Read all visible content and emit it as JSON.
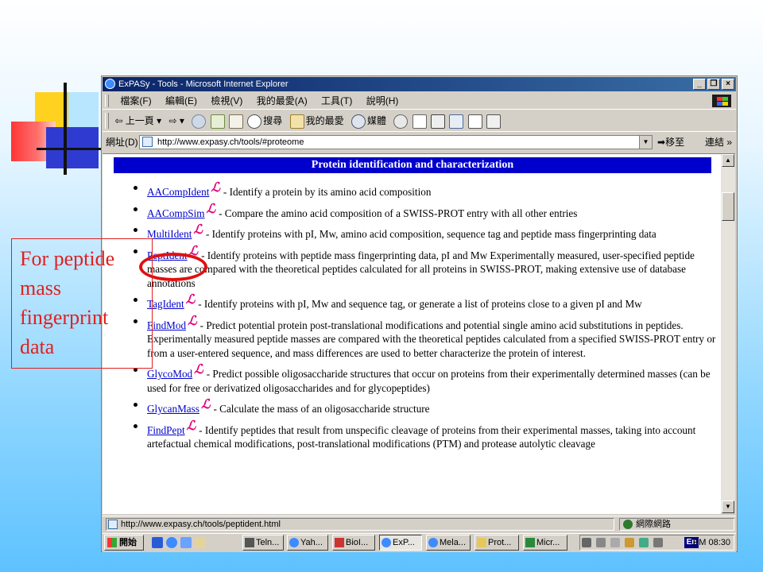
{
  "window": {
    "title": "ExPASy - Tools - Microsoft Internet Explorer",
    "controls": [
      "_",
      "❐",
      "×"
    ]
  },
  "menu": [
    "檔案(F)",
    "編輯(E)",
    "檢視(V)",
    "我的最愛(A)",
    "工具(T)",
    "說明(H)"
  ],
  "toolbar": {
    "back": "上一頁",
    "search": "搜尋",
    "favorites": "我的最愛",
    "media": "媒體"
  },
  "address": {
    "label": "網址(D)",
    "url": "http://www.expasy.ch/tools/#proteome",
    "go": "移至",
    "links": "連結"
  },
  "page": {
    "heading": "Protein identification and characterization",
    "tools": [
      {
        "name": "AACompIdent",
        "desc": "- Identify a protein by its amino acid composition"
      },
      {
        "name": "AACompSim",
        "desc": "- Compare the amino acid composition of a SWISS-PROT entry with all other entries"
      },
      {
        "name": "MultiIdent",
        "desc": "- Identify proteins with pI, Mw, amino acid composition, sequence tag and peptide mass fingerprinting data"
      },
      {
        "name": "PeptIdent",
        "desc": "- Identify proteins with peptide mass fingerprinting data, pI and Mw Experimentally measured, user-specified peptide masses are compared with the theoretical peptides calculated for all proteins in SWISS-PROT, making extensive use of database annotations"
      },
      {
        "name": "TagIdent",
        "desc": "- Identify proteins with pI, Mw and sequence tag, or generate a list of proteins close to a given pI and Mw"
      },
      {
        "name": "FindMod",
        "desc": "- Predict potential protein post-translational modifications and potential single amino acid substitutions in peptides. Experimentally measured peptide masses are compared with the theoretical peptides calculated from a specified SWISS-PROT entry or from a user-entered sequence, and mass differences are used to better characterize the protein of interest."
      },
      {
        "name": "GlycoMod",
        "desc": "- Predict possible oligosaccharide structures that occur on proteins from their experimentally determined masses (can be used for free or derivatized oligosaccharides and for glycopeptides)"
      },
      {
        "name": "GlycanMass",
        "desc": "- Calculate the mass of an oligosaccharide structure"
      },
      {
        "name": "FindPept",
        "desc": "- Identify peptides that result from unspecific cleavage of proteins from their experimental masses, taking into account artefactual chemical modifications, post-translational modifications (PTM) and protease autolytic cleavage"
      }
    ]
  },
  "status": {
    "url": "http://www.expasy.ch/tools/peptident.html",
    "zone": "網際網路"
  },
  "taskbar": {
    "start": "開始",
    "tasks": [
      "Teln...",
      "Yah...",
      "BioI...",
      "ExP...",
      "Mela...",
      "Prot...",
      "Micr..."
    ],
    "lang": "En",
    "clock": "PM 08:30"
  },
  "annotation": {
    "lines": [
      "For peptide",
      "mass",
      "fingerprint",
      "data"
    ]
  },
  "colors": {
    "banner": "#0000cc",
    "link": "#0000cc",
    "annotation": "#e02020"
  }
}
